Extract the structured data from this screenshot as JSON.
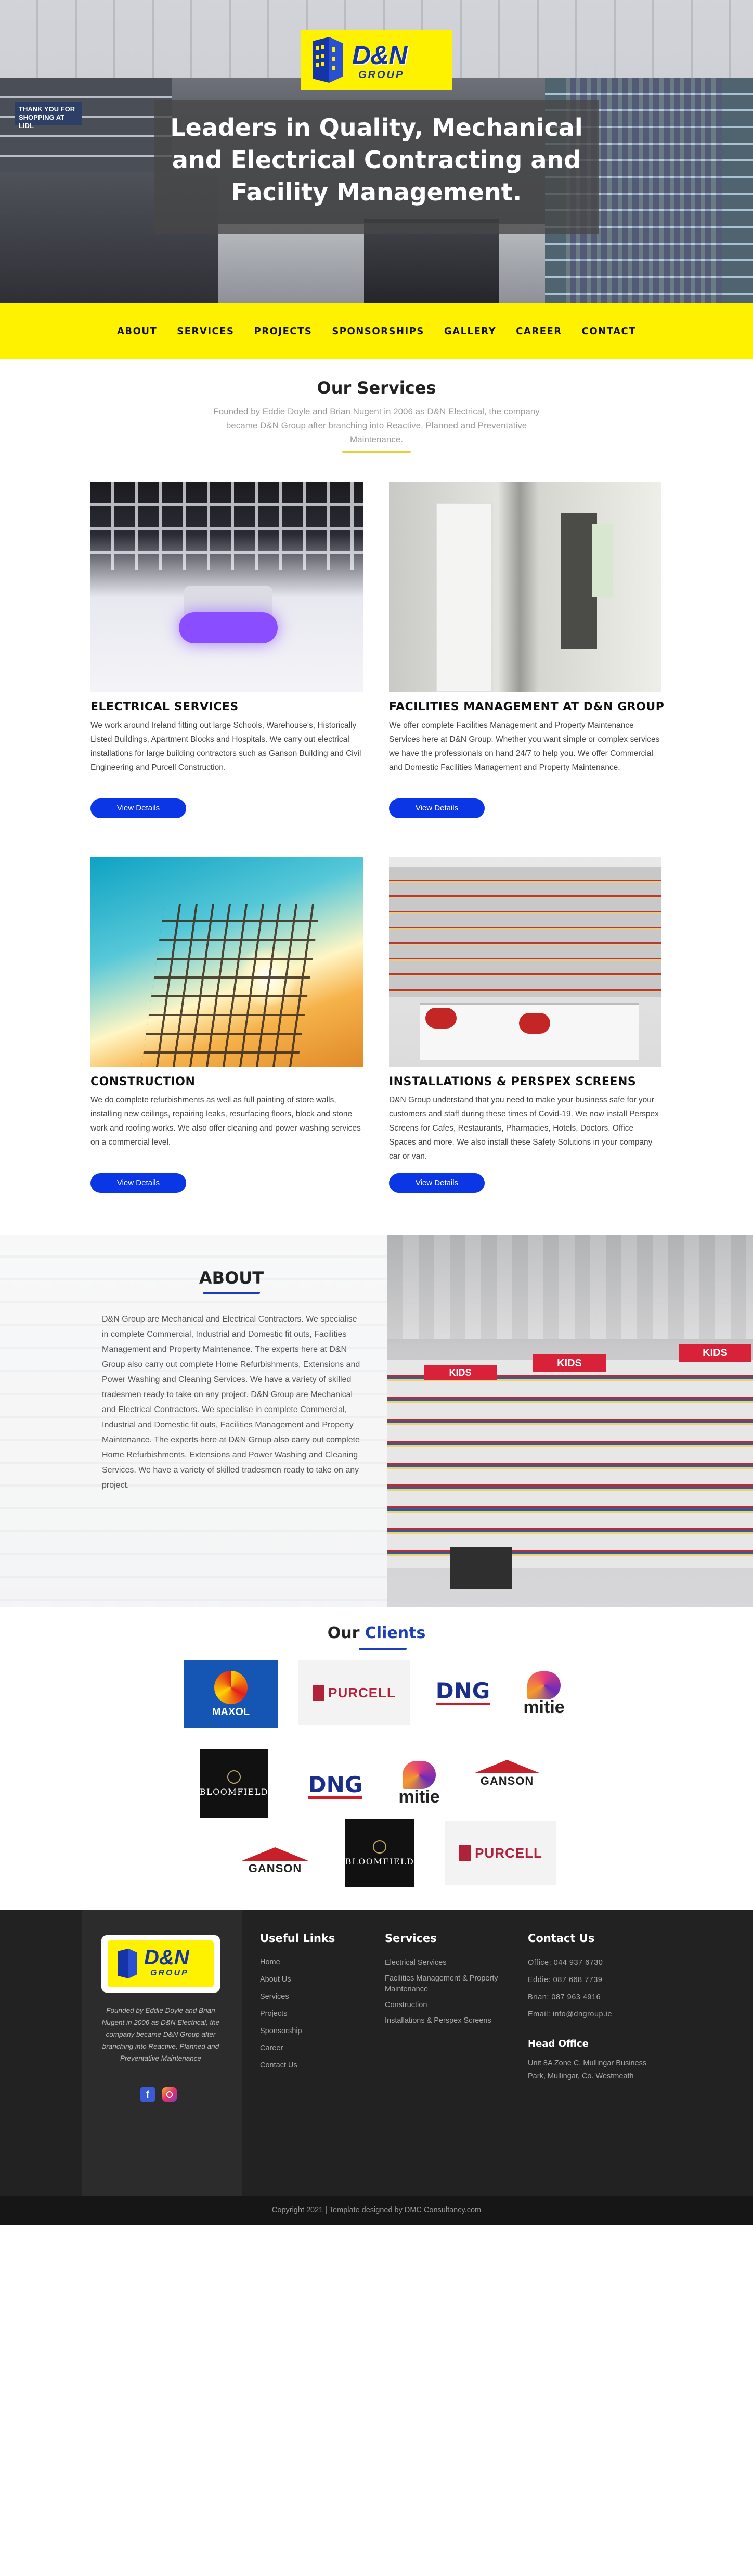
{
  "brand": {
    "name": "D&N",
    "sub": "GROUP"
  },
  "hero": {
    "store_sign": "THANK YOU FOR SHOPPING AT LIDL",
    "title": "Leaders in Quality, Mechanical and Electrical Contracting and Facility Management."
  },
  "nav": [
    "ABOUT",
    "SERVICES",
    "PROJECTS",
    "SPONSORSHIPS",
    "GALLERY",
    "CAREER",
    "CONTACT"
  ],
  "services": {
    "title": "Our Services",
    "subtitle": "Founded by Eddie Doyle and Brian Nugent in 2006 as D&N Electrical, the company became D&N Group after branching into Reactive, Planned and Preventative Maintenance.",
    "accent": "#e6cf2e",
    "cards": [
      {
        "title": "ELECTRICAL SERVICES",
        "text": "We work around Ireland fitting out large Schools, Warehouse's, Historically Listed Buildings, Apartment Blocks and Hospitals. We carry out electrical installations for large building contractors such as Ganson Building and Civil Engineering and Purcell Construction.",
        "button": "View Details"
      },
      {
        "title": "FACILITIES MANAGEMENT AT D&N GROUP",
        "text": "We offer complete Facilities Management and Property Maintenance Services here at D&N Group. Whether you want simple or complex services we have the professionals on hand 24/7 to help you. We offer Commercial and Domestic Facilities Management and Property Maintenance.",
        "button": "View Details"
      },
      {
        "title": "CONSTRUCTION",
        "text": "We do complete refurbishments as well as full painting of store walls, installing new ceilings, repairing leaks, resurfacing floors, block and stone work and roofing works. We also offer cleaning and power washing services on a commercial level.",
        "button": "View Details"
      },
      {
        "title": "INSTALLATIONS & PERSPEX SCREENS",
        "text": "D&N Group understand that you need to make your business safe for your customers and staff during these times of Covid-19. We now install Perspex Screens for Cafes, Restaurants, Pharmacies, Hotels, Doctors, Office Spaces and more. We also install these Safety Solutions in your company car or van.",
        "button": "View Details"
      }
    ]
  },
  "about": {
    "title": "ABOUT",
    "accent": "#1c3fb8",
    "text": "D&N Group are Mechanical and Electrical Contractors. We specialise in complete Commercial, Industrial and Domestic fit outs, Facilities Management and Property Maintenance. The experts here at D&N Group also carry out complete Home Refurbishments, Extensions and Power Washing and Cleaning Services. We have a variety of skilled tradesmen ready to take on any project. D&N Group are Mechanical and Electrical Contractors. We specialise in complete Commercial, Industrial and Domestic fit outs, Facilities Management and Property Maintenance. The experts here at D&N Group also carry out complete Home Refurbishments, Extensions and Power Washing and Cleaning Services. We have a variety of skilled tradesmen ready to take on any project.",
    "signs": [
      "KIDS",
      "KIDS",
      "KIDS"
    ]
  },
  "clients": {
    "title_a": "Our",
    "title_b": "Clients",
    "logos": {
      "maxol": "MAXOL",
      "purcell": "PURCELL",
      "dng": "DNG",
      "mitie": "mitie",
      "bloomfield": "BLOOMFIELD",
      "ganson": "GANSON"
    }
  },
  "footer": {
    "description": "Founded by Eddie Doyle and Brian Nugent in 2006 as D&N Electrical, the company became D&N Group after branching into Reactive, Planned and Preventative Maintenance",
    "useful_links_title": "Useful Links",
    "useful_links": [
      "Home",
      "About Us",
      "Services",
      "Projects",
      "Sponsorship",
      "Career",
      "Contact Us"
    ],
    "services_title": "Services",
    "services": [
      "Electrical Services",
      "Facilities Management & Property Maintenance",
      "Construction",
      "Installations & Perspex Screens"
    ],
    "contact_title": "Contact Us",
    "contact": [
      "Office: 044 937 6730",
      "Eddie: 087 668 7739",
      "Brian: 087 963 4916",
      "Email: info@dngroup.ie"
    ],
    "office_title": "Head Office",
    "office_address": "Unit 8A Zone C, Mullingar Business Park, Mullingar, Co. Westmeath",
    "copyright": "Copyright 2021 | Template designed by DMC Consultancy.com"
  },
  "colors": {
    "brand_yellow": "#fff200",
    "brand_blue": "#1434a8",
    "button_blue": "#0a36e6"
  },
  "icons": [
    "facebook-icon",
    "instagram-icon"
  ]
}
